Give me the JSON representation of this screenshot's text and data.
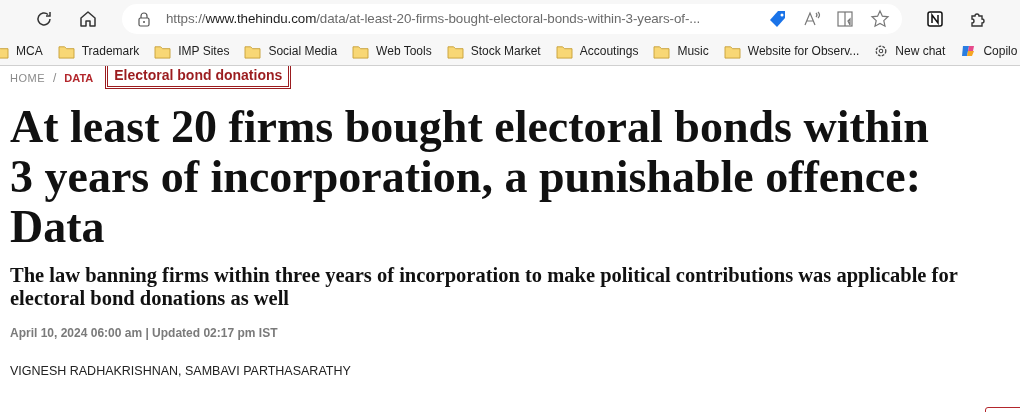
{
  "address_bar": {
    "url": {
      "scheme": "https://",
      "host": "www.thehindu.com",
      "path": "/data/at-least-20-firms-bought-electoral-bonds-within-3-years-of-..."
    }
  },
  "bookmarks": [
    {
      "label": "MCA",
      "kind": "folder"
    },
    {
      "label": "Trademark",
      "kind": "folder"
    },
    {
      "label": "IMP Sites",
      "kind": "folder"
    },
    {
      "label": "Social Media",
      "kind": "folder"
    },
    {
      "label": "Web Tools",
      "kind": "folder"
    },
    {
      "label": "Stock Market",
      "kind": "folder"
    },
    {
      "label": "Accoutings",
      "kind": "folder"
    },
    {
      "label": "Music",
      "kind": "folder"
    },
    {
      "label": "Website for Observ...",
      "kind": "folder"
    },
    {
      "label": "New chat",
      "kind": "chat"
    },
    {
      "label": "Copilo",
      "kind": "copilot"
    }
  ],
  "breadcrumb": {
    "home": "HOME",
    "separator": "/",
    "section": "DATA",
    "topic": "Electoral bond donations"
  },
  "article": {
    "headline": "At least 20 firms bought electoral bonds within 3 years of incorporation, a punishable offence: Data",
    "subheadline": "The law banning firms within three years of incorporation to make political contributions was applicable for electoral bond donations as well",
    "dateline": "April 10, 2024 06:00 am | Updated 02:17 pm IST",
    "authors": "VIGNESH RADHAKRISHNAN,  SAMBAVI PARTHASARATHY"
  }
}
